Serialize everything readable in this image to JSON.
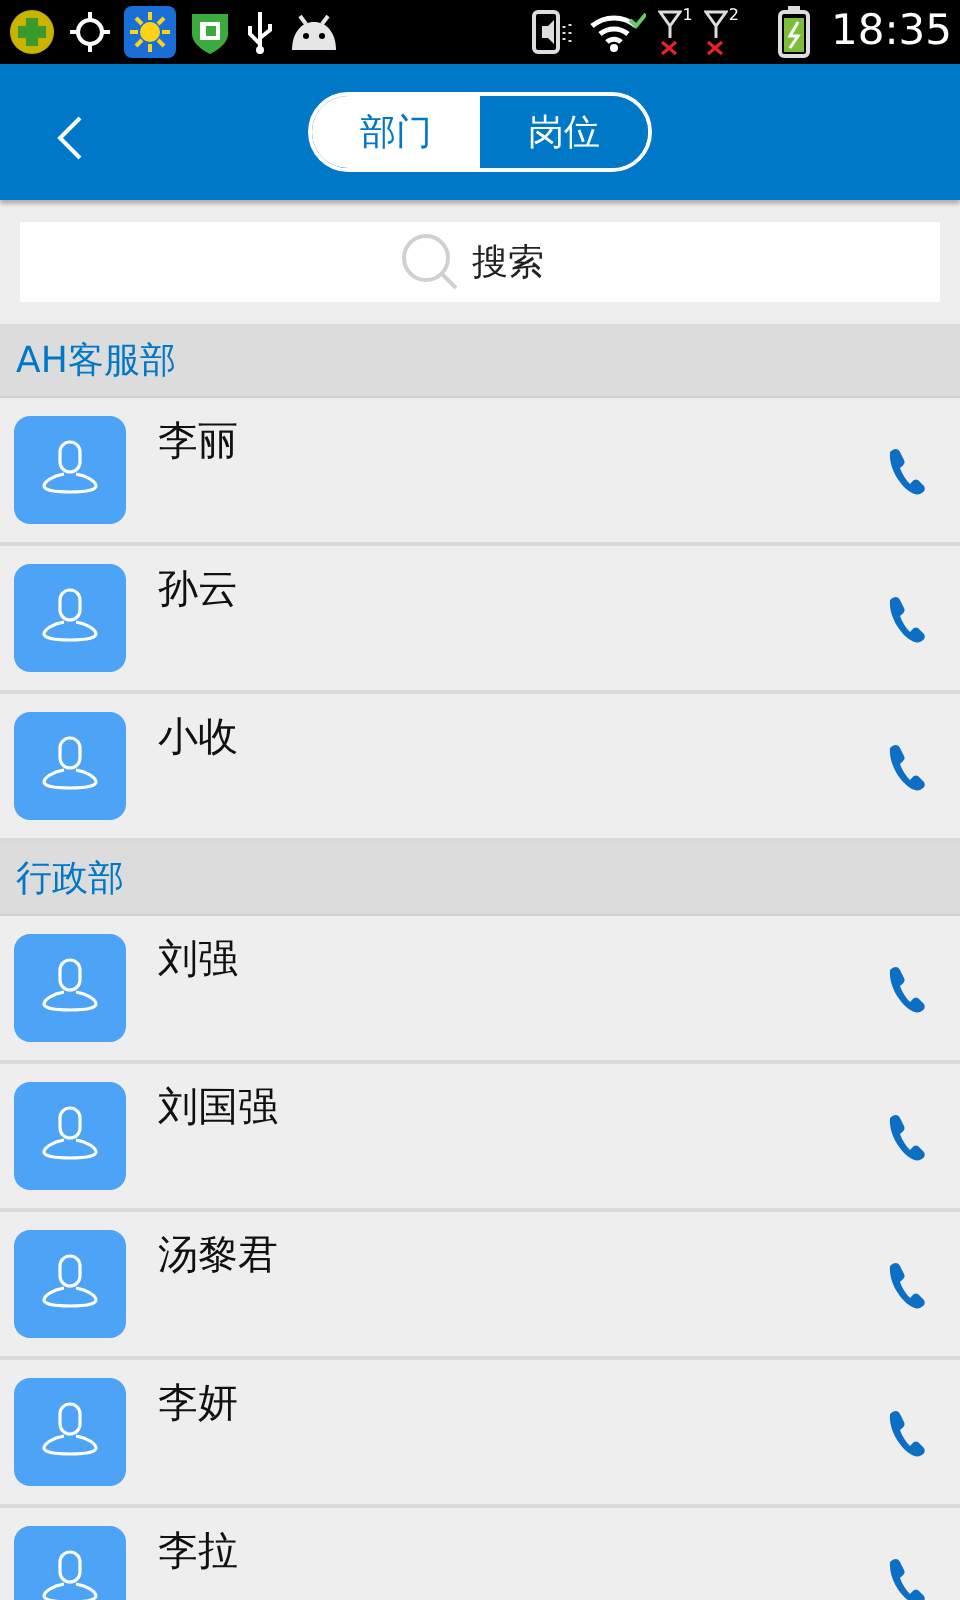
{
  "status_bar": {
    "sim_labels": [
      "1",
      "2"
    ],
    "time": "18:35"
  },
  "header": {
    "tabs": [
      {
        "label": "部门",
        "selected": true
      },
      {
        "label": "岗位",
        "selected": false
      }
    ]
  },
  "search": {
    "placeholder": "搜索"
  },
  "sections": [
    {
      "name": "AH客服部",
      "contacts": [
        {
          "name": "李丽"
        },
        {
          "name": "孙云"
        },
        {
          "name": "小收"
        }
      ]
    },
    {
      "name": "行政部",
      "contacts": [
        {
          "name": "刘强"
        },
        {
          "name": "刘国强"
        },
        {
          "name": "汤黎君"
        },
        {
          "name": "李妍"
        },
        {
          "name": "李拉"
        }
      ]
    }
  ]
}
